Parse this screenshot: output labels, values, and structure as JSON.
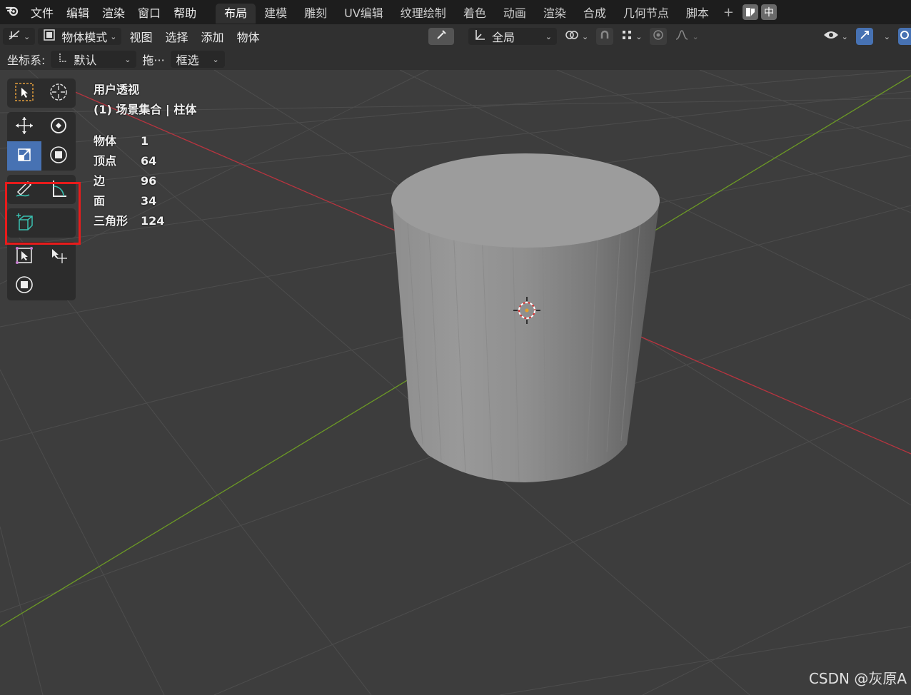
{
  "menu": {
    "items": [
      "文件",
      "编辑",
      "渲染",
      "窗口",
      "帮助"
    ]
  },
  "workspaces": {
    "tabs": [
      "布局",
      "建模",
      "雕刻",
      "UV编辑",
      "纹理绘制",
      "着色",
      "动画",
      "渲染",
      "合成",
      "几何节点",
      "脚本"
    ],
    "active": "布局",
    "add_label": "+",
    "right_btn_label": "中"
  },
  "header": {
    "mode_label": "物体模式",
    "menus": [
      "视图",
      "选择",
      "添加",
      "物体"
    ],
    "orientation_label": "全局"
  },
  "tool_settings": {
    "coord_label": "坐标系:",
    "coord_value": "默认",
    "drag_label": "拖···",
    "select_value": "框选"
  },
  "viewport": {
    "view_name": "用户透视",
    "collection": "(1) 场景集合 | 柱体",
    "stats": [
      {
        "label": "物体",
        "value": "1"
      },
      {
        "label": "顶点",
        "value": "64"
      },
      {
        "label": "边",
        "value": "96"
      },
      {
        "label": "面",
        "value": "34"
      },
      {
        "label": "三角形",
        "value": "124"
      }
    ]
  },
  "watermark": "CSDN @灰原A",
  "colors": {
    "active_tool": "#4772b3",
    "highlight": "#e81b1b",
    "x_axis": "#b8343f",
    "y_axis": "#6c9a25"
  }
}
